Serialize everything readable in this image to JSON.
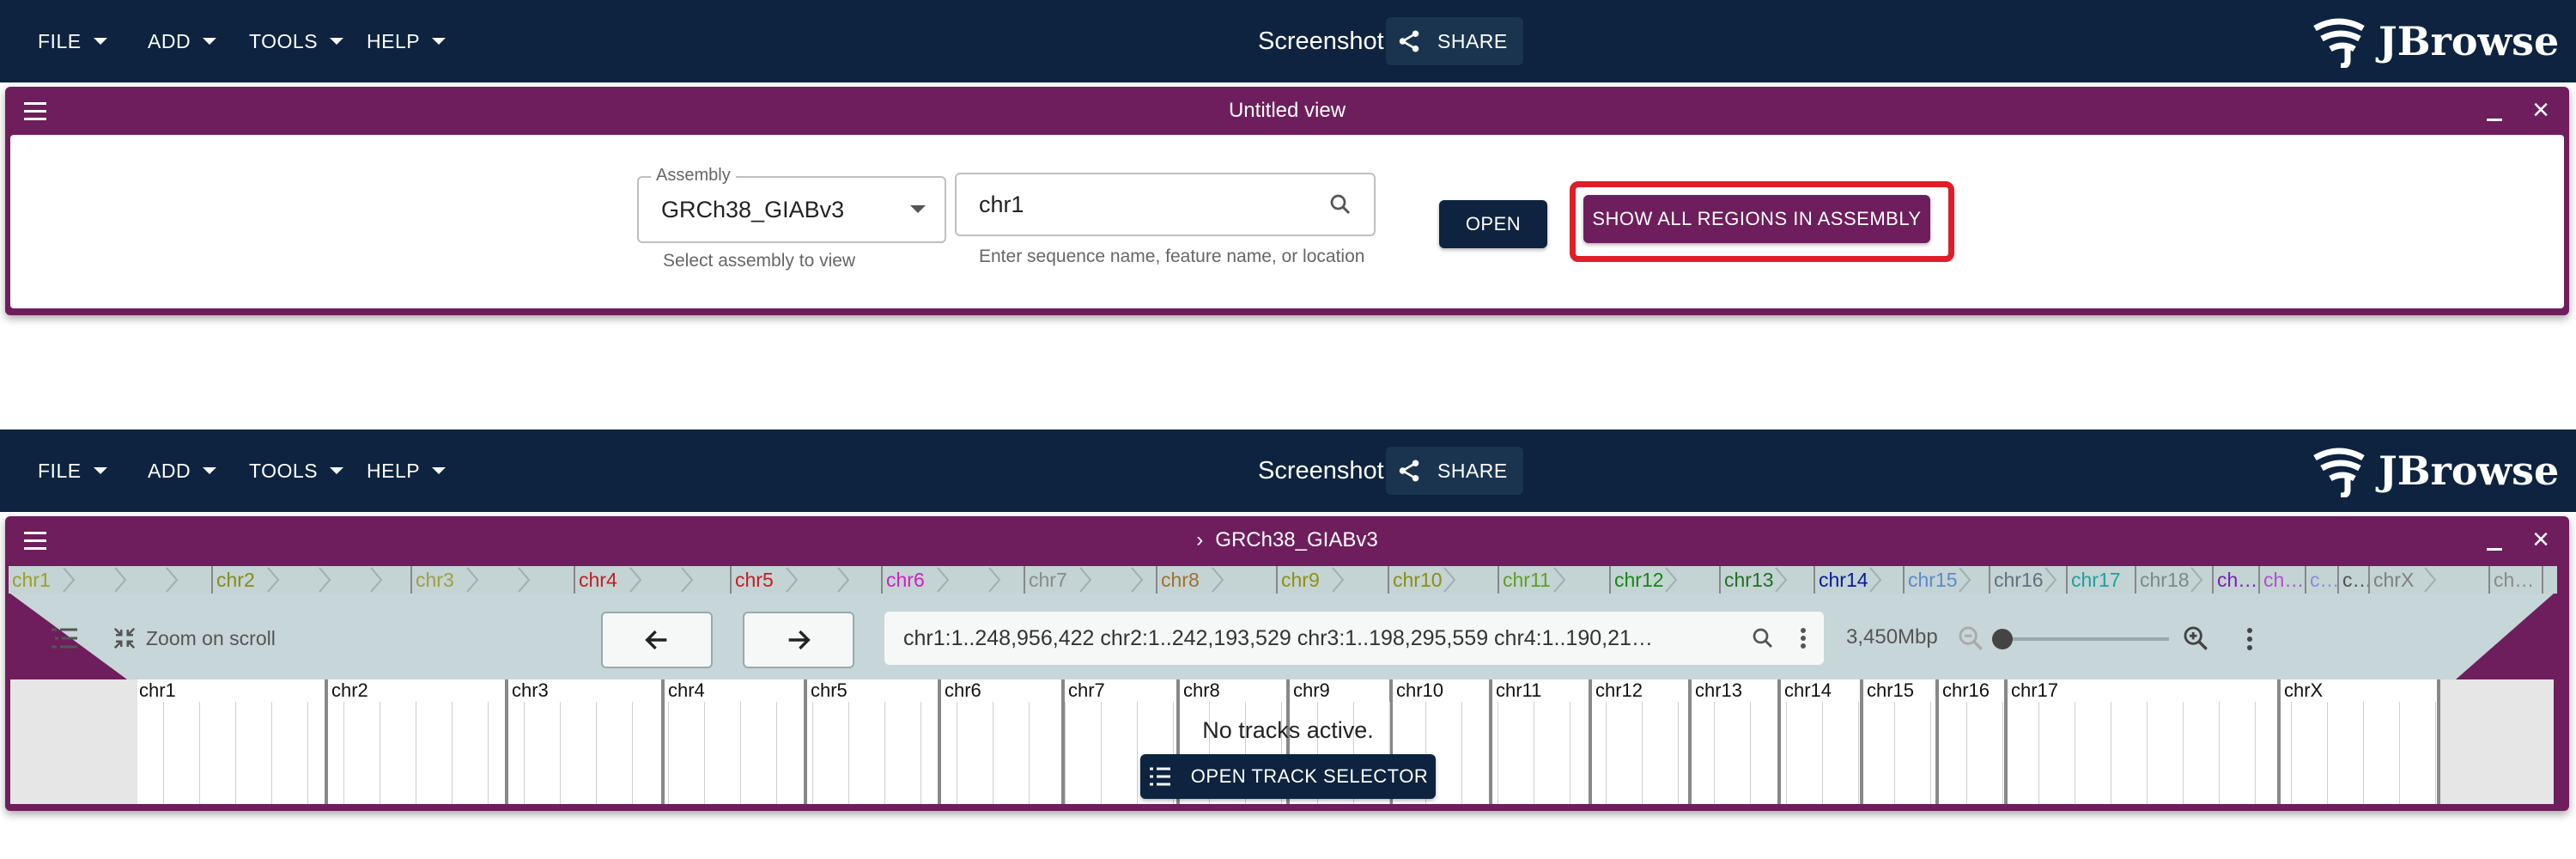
{
  "appbar": {
    "menus": [
      "FILE",
      "ADD",
      "TOOLS",
      "HELP"
    ],
    "title": "Screenshot",
    "share_label": "SHARE",
    "logo_text": "JBrowse"
  },
  "view1": {
    "title": "Untitled view",
    "assembly_label": "Assembly",
    "assembly_value": "GRCh38_GIABv3",
    "assembly_helper": "Select assembly to view",
    "search_value": "chr1",
    "search_helper": "Enter sequence name, feature name, or location",
    "open_label": "OPEN",
    "show_all_label": "SHOW ALL REGIONS IN ASSEMBLY"
  },
  "view2": {
    "title": "GRCh38_GIABv3",
    "zoom_on_scroll": "Zoom on scroll",
    "locstring": "chr1:1..248,956,422 chr2:1..242,193,529 chr3:1..198,295,559 chr4:1..190,21…",
    "bp_label": "3,450Mbp",
    "zoom_level": 0.0,
    "no_tracks": "No tracks active.",
    "track_selector_label": "OPEN TRACK SELECTOR",
    "overview": [
      {
        "label": "chr1",
        "color": "#a0a020"
      },
      {
        "label": "chr2",
        "color": "#8a8a18"
      },
      {
        "label": "chr3",
        "color": "#a0a040"
      },
      {
        "label": "chr4",
        "color": "#c02020"
      },
      {
        "label": "chr5",
        "color": "#c02020"
      },
      {
        "label": "chr6",
        "color": "#d020c0"
      },
      {
        "label": "chr7",
        "color": "#8a8a8a"
      },
      {
        "label": "chr8",
        "color": "#a07030"
      },
      {
        "label": "chr9",
        "color": "#909010"
      },
      {
        "label": "chr10",
        "color": "#8a9010"
      },
      {
        "label": "chr11",
        "color": "#60a020"
      },
      {
        "label": "chr12",
        "color": "#108a10"
      },
      {
        "label": "chr13",
        "color": "#207020"
      },
      {
        "label": "chr14",
        "color": "#0a1a9a"
      },
      {
        "label": "chr15",
        "color": "#5a8ad0"
      },
      {
        "label": "chr16",
        "color": "#607080"
      },
      {
        "label": "chr17",
        "color": "#20a0a0"
      },
      {
        "label": "chr18",
        "color": "#7a8a8a"
      },
      {
        "label": "ch…",
        "color": "#7a20b0"
      },
      {
        "label": "ch…",
        "color": "#b050d0"
      },
      {
        "label": "c…",
        "color": "#8a8ae0"
      },
      {
        "label": "c…",
        "color": "#505050"
      },
      {
        "label": "chrX",
        "color": "#808080"
      },
      {
        "label": "ch…",
        "color": "#8a8a8a"
      }
    ],
    "ruler": [
      "chr1",
      "chr2",
      "chr3",
      "chr4",
      "chr5",
      "chr6",
      "chr7",
      "chr8",
      "chr9",
      "chr10",
      "chr11",
      "chr12",
      "chr13",
      "chr14",
      "chr15",
      "chr16",
      "chr17",
      "chrX"
    ]
  }
}
